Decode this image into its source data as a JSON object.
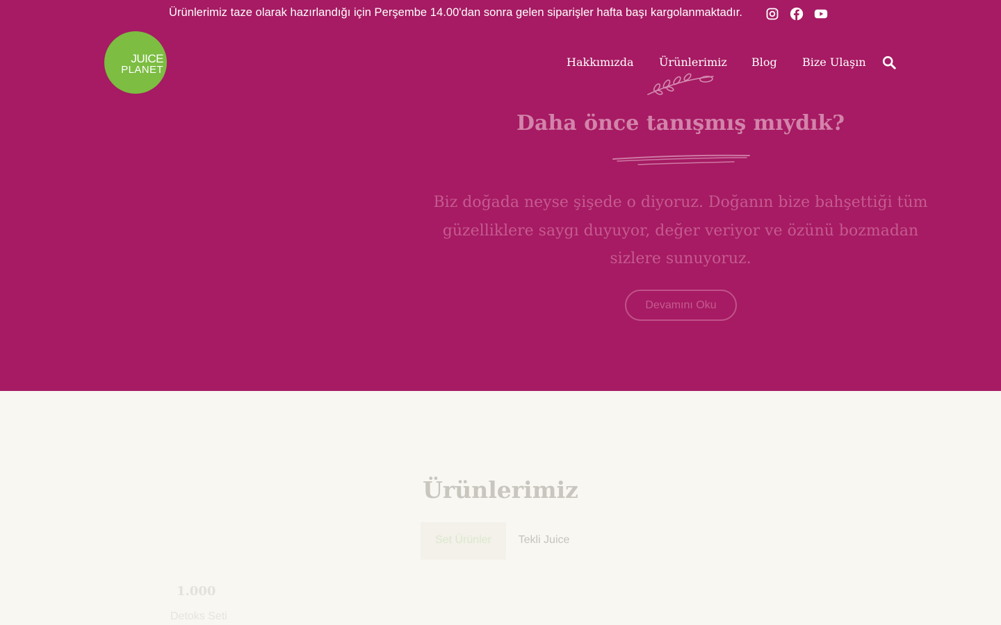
{
  "topbar": {
    "announcement": "Ürünlerimiz taze olarak hazırlandığı için Perşembe 14.00'dan sonra gelen siparişler hafta başı kargolanmaktadır.",
    "social_icons": [
      "instagram-icon",
      "facebook-icon",
      "youtube-icon"
    ]
  },
  "logo": {
    "line1": "JUICE",
    "line2": "PLANET"
  },
  "nav": {
    "items": [
      {
        "label": "Hakkımızda"
      },
      {
        "label": "Ürünlerimiz"
      },
      {
        "label": "Blog"
      },
      {
        "label": "Bize Ulaşın"
      }
    ],
    "search_icon": "search-icon"
  },
  "hero": {
    "title": "Daha önce tanışmış mıydık?",
    "text": "Biz doğada neyse şişede o diyoruz. Doğanın bize bahşettiği tüm güzelliklere saygı duyuyor, değer veriyor ve özünü bozmadan sizlere sunuyoruz.",
    "button": "Devamını Oku"
  },
  "products": {
    "title": "Ürünlerimiz",
    "tabs": [
      {
        "label": "Set Ürünler",
        "active": true
      },
      {
        "label": "Tekli Juice",
        "active": false
      }
    ],
    "items": [
      {
        "price": "1.000",
        "name": "Detoks Seti"
      }
    ]
  },
  "colors": {
    "hero_bg": "#a61b63",
    "logo_green": "#7cbd42",
    "page_bg": "#f8f7f2"
  }
}
